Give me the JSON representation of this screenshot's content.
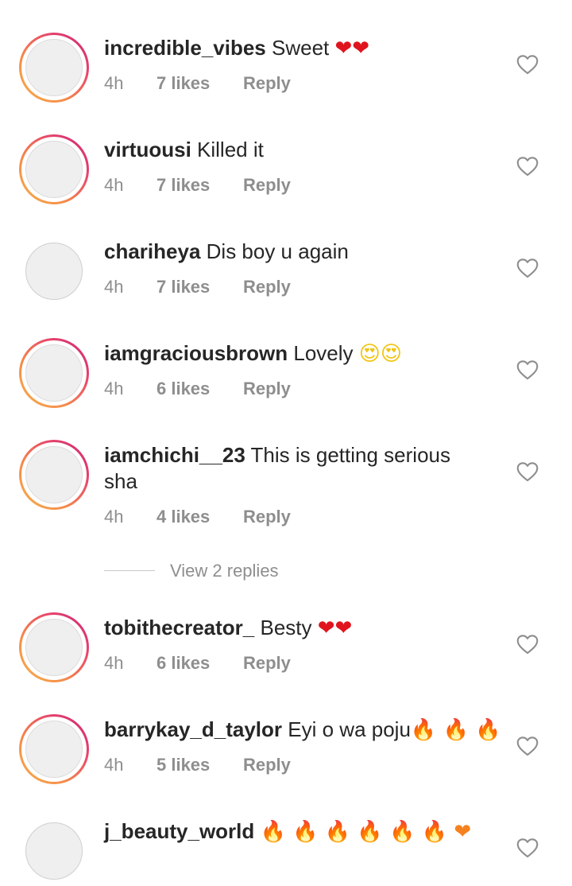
{
  "comments": [
    {
      "username": "incredible_vibes",
      "text": "Sweet",
      "emoji": "❤❤",
      "time": "4h",
      "likes": "7 likes",
      "reply": "Reply",
      "story_ring": true
    },
    {
      "username": "virtuousi",
      "text": "Killed it",
      "emoji": "",
      "time": "4h",
      "likes": "7 likes",
      "reply": "Reply",
      "story_ring": true
    },
    {
      "username": "chariheya",
      "text": "Dis boy u again",
      "emoji": "",
      "time": "4h",
      "likes": "7 likes",
      "reply": "Reply",
      "story_ring": false
    },
    {
      "username": "iamgraciousbrown",
      "text": "Lovely",
      "emoji": "😍😍",
      "time": "4h",
      "likes": "6 likes",
      "reply": "Reply",
      "story_ring": true
    },
    {
      "username": "iamchichi__23",
      "text": "This is getting serious sha",
      "emoji": "",
      "time": "4h",
      "likes": "4 likes",
      "reply": "Reply",
      "story_ring": true
    },
    {
      "username": "tobithecreator_",
      "text": "Besty",
      "emoji": "❤❤",
      "time": "4h",
      "likes": "6 likes",
      "reply": "Reply",
      "story_ring": true
    },
    {
      "username": "barrykay_d_taylor",
      "text": "Eyi o wa poju",
      "emoji": "🔥 🔥 🔥",
      "time": "4h",
      "likes": "5 likes",
      "reply": "Reply",
      "story_ring": true
    },
    {
      "username": "j_beauty_world",
      "text": "",
      "emoji": "🔥 🔥 🔥 🔥 🔥 🔥 ❤",
      "time": "",
      "likes": "",
      "reply": "",
      "story_ring": false
    }
  ],
  "view_replies": "View 2 replies",
  "icons": {
    "like": "heart-outline-icon"
  },
  "colors": {
    "text": "#262626",
    "meta": "#8e8e8e",
    "heart_red": "#e0141e"
  }
}
